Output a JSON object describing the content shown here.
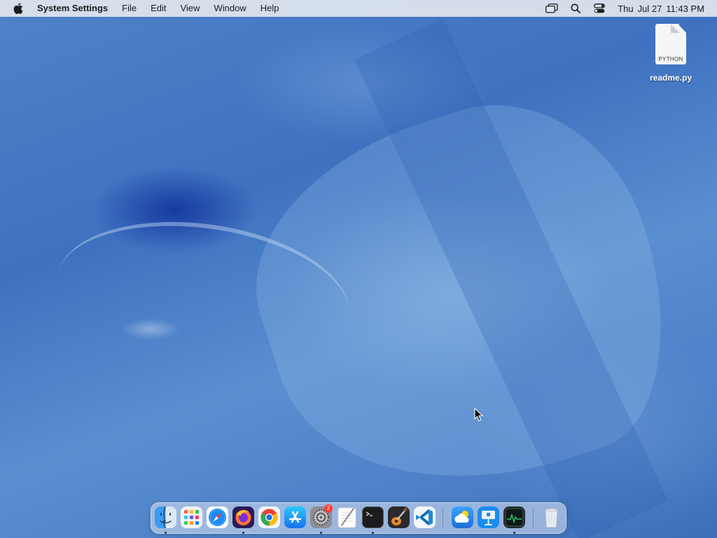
{
  "menubar": {
    "app_name": "System Settings",
    "menus": [
      "File",
      "Edit",
      "View",
      "Window",
      "Help"
    ],
    "status_icons": [
      "screen-mirroring-icon",
      "spotlight-search-icon",
      "control-center-icon"
    ],
    "clock": {
      "day": "Thu",
      "date": "Jul 27",
      "time": "11:43 PM"
    }
  },
  "desktop_file": {
    "name": "readme.py",
    "type_label": "PYTHON"
  },
  "dock": {
    "apps": [
      {
        "name": "Finder",
        "icon": "finder-icon",
        "running": true
      },
      {
        "name": "Launchpad",
        "icon": "launchpad-icon",
        "running": false
      },
      {
        "name": "Safari",
        "icon": "safari-icon",
        "running": false
      },
      {
        "name": "Firefox",
        "icon": "firefox-icon",
        "running": true
      },
      {
        "name": "Google Chrome",
        "icon": "chrome-icon",
        "running": false
      },
      {
        "name": "App Store",
        "icon": "app-store-icon",
        "running": false
      },
      {
        "name": "System Settings",
        "icon": "system-settings-icon",
        "running": true,
        "badge": "2"
      },
      {
        "name": "TextEdit",
        "icon": "textedit-icon",
        "running": false
      },
      {
        "name": "Terminal",
        "icon": "terminal-icon",
        "running": true
      },
      {
        "name": "GarageBand",
        "icon": "garageband-icon",
        "running": false
      },
      {
        "name": "Visual Studio Code",
        "icon": "vscode-icon",
        "running": false
      }
    ],
    "recents": [
      {
        "name": "Weather",
        "icon": "weather-icon",
        "running": false
      },
      {
        "name": "Keynote",
        "icon": "keynote-icon",
        "running": false
      },
      {
        "name": "Activity Monitor",
        "icon": "activity-monitor-icon",
        "running": true
      }
    ],
    "trash": {
      "name": "Trash",
      "icon": "trash-icon"
    }
  },
  "colors": {
    "wallpaper_base": "#4a7dc6",
    "menubar": "#e2e6ee",
    "badge": "#ff3b30"
  }
}
